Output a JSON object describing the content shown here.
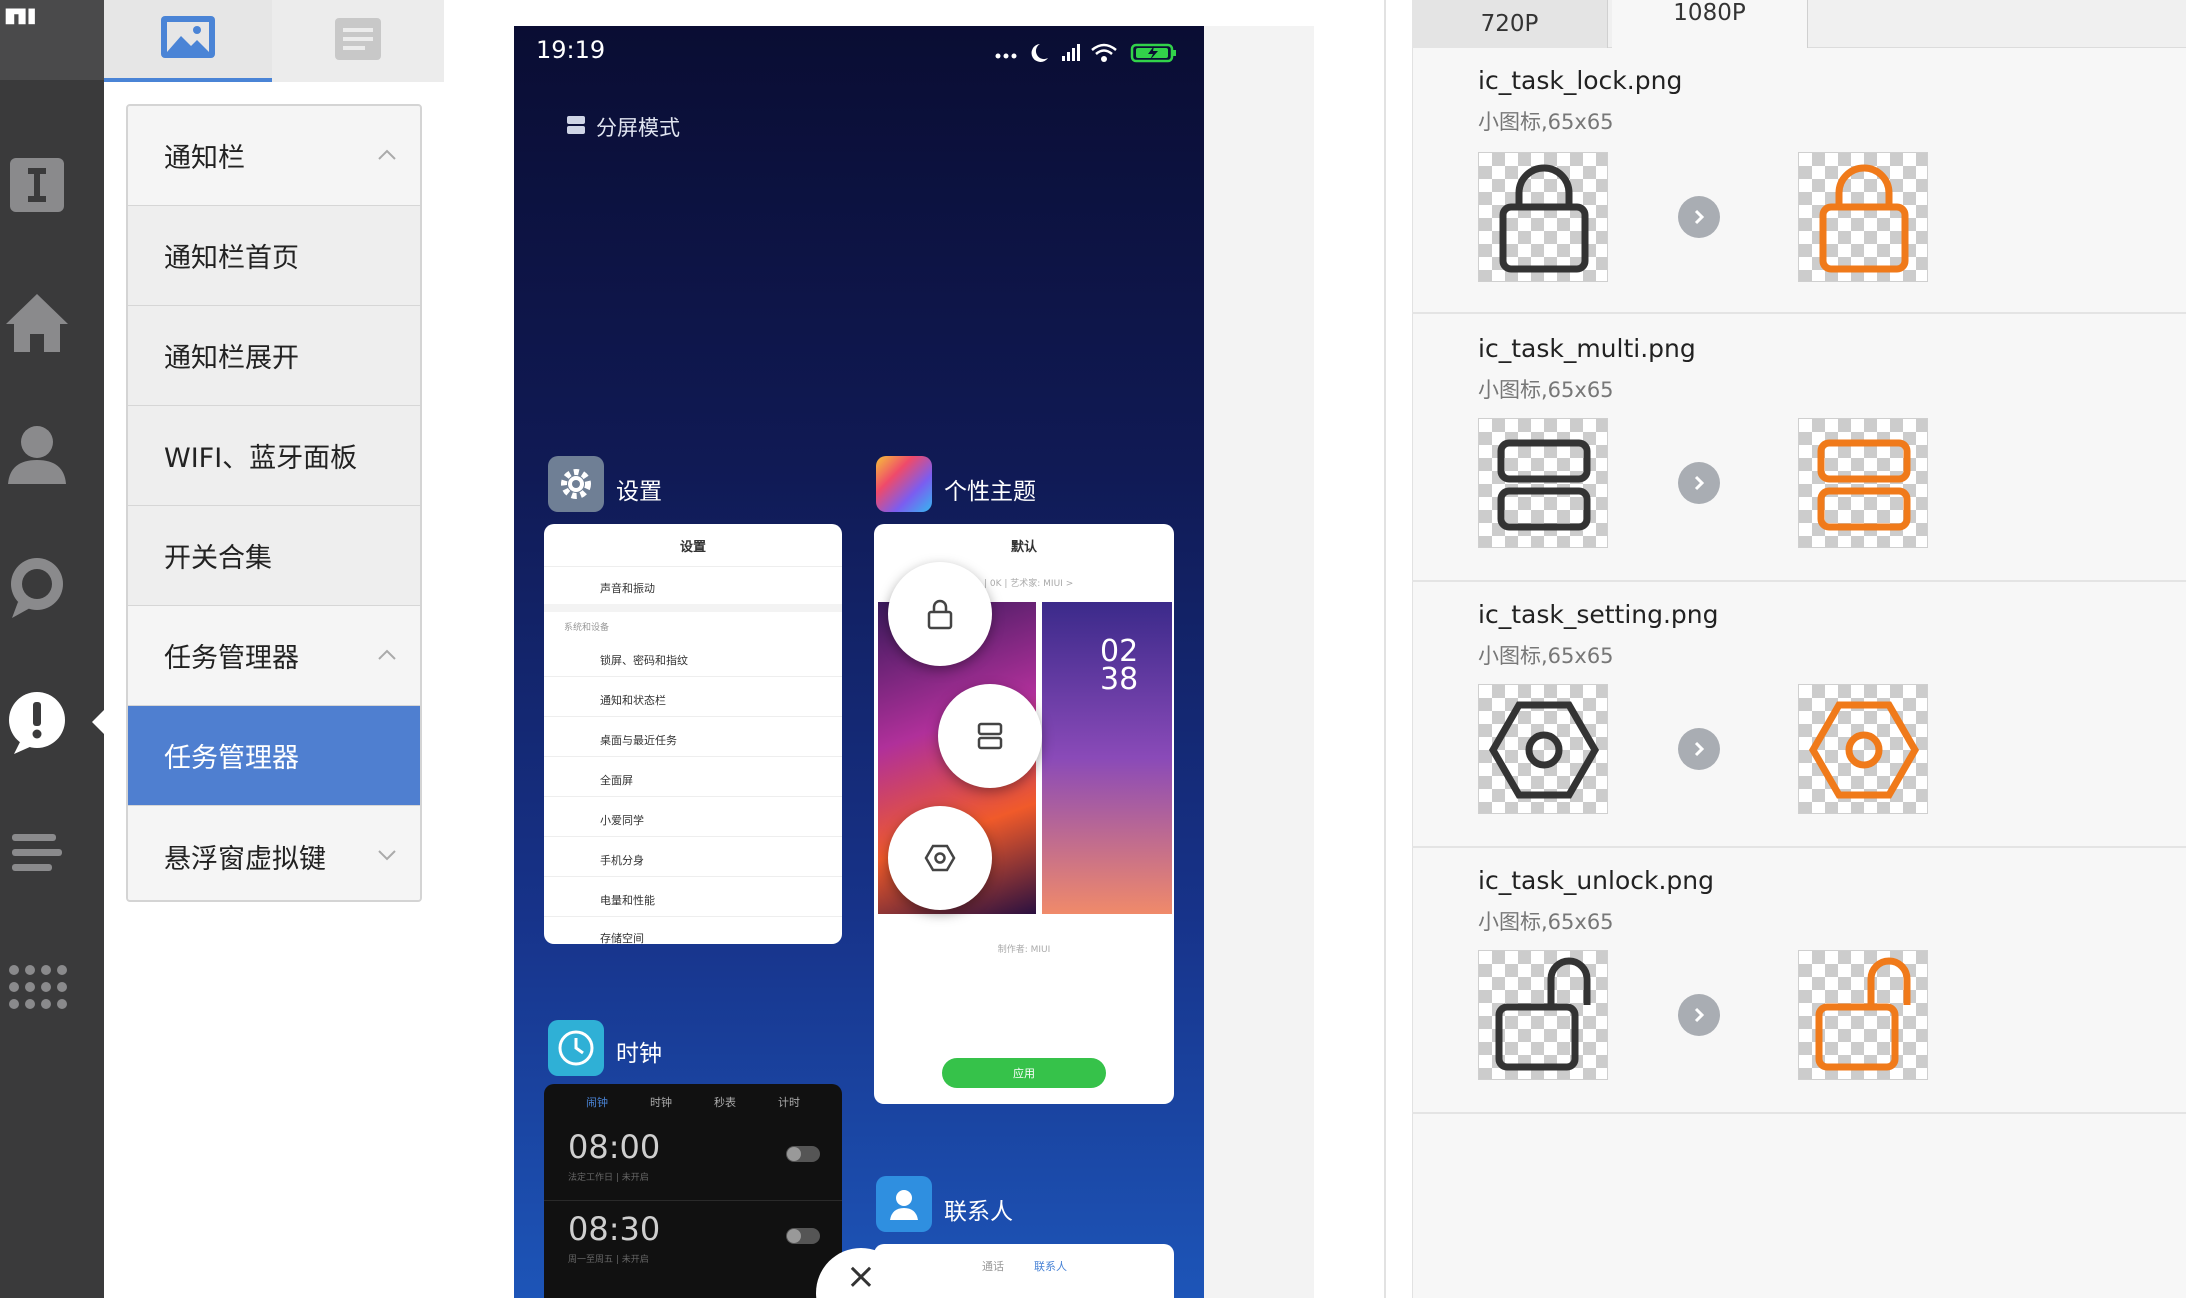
{
  "rail": {
    "logo_text": "mi",
    "icons": [
      "text-icon",
      "home-icon",
      "user-icon",
      "chat-icon",
      "alert-icon",
      "list-icon",
      "apps-icon"
    ],
    "active_icon": "alert-icon"
  },
  "top_tabs": [
    {
      "name": "image-tab-icon",
      "active": true
    },
    {
      "name": "document-tab-icon",
      "active": false
    }
  ],
  "menu": {
    "items": [
      {
        "label": "通知栏",
        "type": "header",
        "chevron": "up"
      },
      {
        "label": "通知栏首页",
        "type": "sub"
      },
      {
        "label": "通知栏展开",
        "type": "sub"
      },
      {
        "label": "WIFI、蓝牙面板",
        "type": "sub"
      },
      {
        "label": "开关合集",
        "type": "sub"
      },
      {
        "label": "任务管理器",
        "type": "header",
        "chevron": "up"
      },
      {
        "label": "任务管理器",
        "type": "selected"
      },
      {
        "label": "悬浮窗虚拟键",
        "type": "header",
        "chevron": "down"
      }
    ]
  },
  "phone": {
    "status_time": "19:19",
    "split_mode_label": "分屏模式",
    "settings_app": {
      "title": "设置",
      "card_title": "设置",
      "first_row": "声音和振动",
      "section": "系统和设备",
      "rows": [
        "锁屏、密码和指纹",
        "通知和状态栏",
        "桌面与最近任务",
        "全面屏",
        "小爱同学",
        "手机分身",
        "电量和性能",
        "存储空间"
      ]
    },
    "theme_app": {
      "title": "个性主题",
      "card_title": "默认",
      "card_sub": "| 0K | 艺术家: MIUI  >",
      "clock_big": "02\n38",
      "author": "制作者: MIUI",
      "apply_btn": "应用"
    },
    "clock_app": {
      "title": "时钟",
      "tabs": [
        "闹钟",
        "时钟",
        "秒表",
        "计时"
      ],
      "alarms": [
        {
          "time": "08:00",
          "note": "法定工作日 | 未开启"
        },
        {
          "time": "08:30",
          "note": "周一至周五 | 未开启"
        }
      ]
    },
    "contacts_app": {
      "title": "联系人",
      "tabs": [
        "通话",
        "联系人"
      ]
    },
    "close_symbol": "×"
  },
  "resolution_tabs": [
    "720P",
    "1080P"
  ],
  "active_resolution": "1080P",
  "assets": [
    {
      "file": "ic_task_lock.png",
      "desc": "小图标,65x65",
      "icon": "lock-icon"
    },
    {
      "file": "ic_task_multi.png",
      "desc": "小图标,65x65",
      "icon": "split-icon"
    },
    {
      "file": "ic_task_setting.png",
      "desc": "小图标,65x65",
      "icon": "hexagon-settings-icon"
    },
    {
      "file": "ic_task_unlock.png",
      "desc": "小图标,65x65",
      "icon": "unlock-icon"
    }
  ],
  "colors": {
    "accent": "#4f7fd0",
    "asset_orange": "#f07a1a",
    "asset_dark": "#333333",
    "rail_bg": "#3a3a3b"
  }
}
